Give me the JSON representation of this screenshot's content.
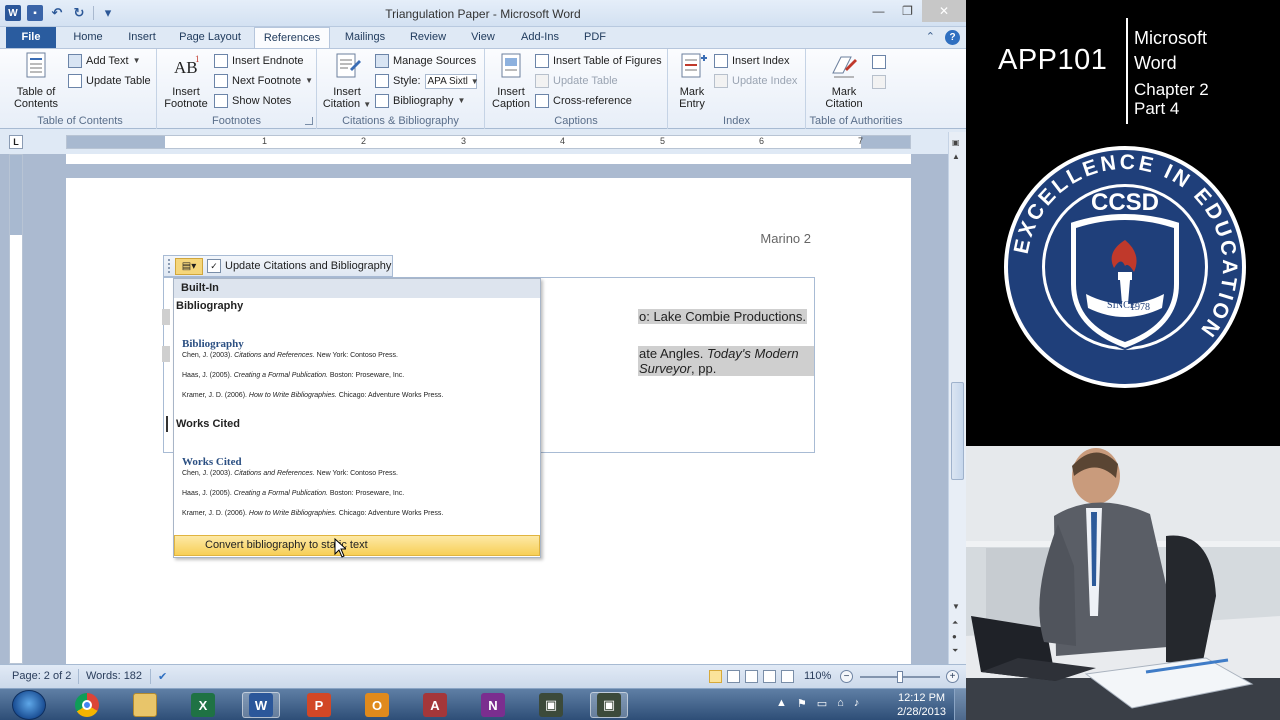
{
  "window": {
    "title": "Triangulation Paper - Microsoft Word"
  },
  "tabs": [
    "File",
    "Home",
    "Insert",
    "Page Layout",
    "References",
    "Mailings",
    "Review",
    "View",
    "Add-Ins",
    "PDF"
  ],
  "ribbon": {
    "toc": {
      "table_of_contents": "Table of Contents",
      "add_text": "Add Text",
      "update_table": "Update Table",
      "group": "Table of Contents"
    },
    "footnotes": {
      "insert_footnote": "Insert Footnote",
      "insert_endnote": "Insert Endnote",
      "next_footnote": "Next Footnote",
      "show_notes": "Show Notes",
      "group": "Footnotes"
    },
    "citations": {
      "insert_citation": "Insert Citation",
      "manage_sources": "Manage Sources",
      "style_label": "Style:",
      "style_value": "APA Sixtl",
      "bibliography": "Bibliography",
      "group": "Citations & Bibliography"
    },
    "captions": {
      "insert_caption": "Insert Caption",
      "insert_tof": "Insert Table of Figures",
      "update_table": "Update Table",
      "cross_reference": "Cross-reference",
      "group": "Captions"
    },
    "index": {
      "mark_entry": "Mark Entry",
      "insert_index": "Insert Index",
      "update_index": "Update Index",
      "group": "Index"
    },
    "toa": {
      "mark_citation": "Mark Citation",
      "group": "Table of Authorities"
    }
  },
  "ruler": [
    "1",
    "2",
    "3",
    "4",
    "5",
    "6",
    "7"
  ],
  "document": {
    "header_name": "Marino 2",
    "line1": "o: Lake Combie Productions.",
    "line2_plain": "ate Angles. ",
    "line2_italic": "Today's Modern Surveyor",
    "line2_end": ", pp."
  },
  "content_control": {
    "update_label": "Update Citations and Bibliography"
  },
  "dropdown": {
    "header": "Built-In",
    "items": [
      {
        "name": "Bibliography",
        "preview_title": "Bibliography",
        "refs": [
          {
            "pre": "Chen, J. (2003). ",
            "title": "Citations and References.",
            "post": " New York: Contoso Press."
          },
          {
            "pre": "Haas, J. (2005). ",
            "title": "Creating a Formal Publication.",
            "post": " Boston: Proseware, Inc."
          },
          {
            "pre": "Kramer, J. D. (2006). ",
            "title": "How to Write Bibliographies.",
            "post": " Chicago: Adventure Works Press."
          }
        ]
      },
      {
        "name": "Works Cited",
        "preview_title": "Works Cited",
        "refs": [
          {
            "pre": "Chen, J. (2003). ",
            "title": "Citations and References.",
            "post": " New York: Contoso Press."
          },
          {
            "pre": "Haas, J. (2005). ",
            "title": "Creating a Formal Publication.",
            "post": " Boston: Proseware, Inc."
          },
          {
            "pre": "Kramer, J. D. (2006). ",
            "title": "How to Write Bibliographies.",
            "post": " Chicago: Adventure Works Press."
          }
        ]
      }
    ],
    "convert": "Convert bibliography to static text"
  },
  "status": {
    "page": "Page: 2 of 2",
    "words": "Words: 182",
    "zoom": "110%"
  },
  "taskbar": {
    "time": "12:12 PM",
    "date": "2/28/2013"
  },
  "overlay": {
    "course": "APP101",
    "topic_line1": "Microsoft",
    "topic_line2": "Word",
    "topic_line3": "Chapter 2",
    "topic_line4": "Part 4",
    "seal_text": "EXCELLENCE IN EDUCATION",
    "seal_name": "CCSD",
    "seal_since": "SINCE",
    "seal_year": "1978"
  },
  "colors": {
    "ribbon_accent": "#2a5c9f",
    "seal_blue": "#1f3f7a",
    "highlight": "#f7cf57"
  }
}
